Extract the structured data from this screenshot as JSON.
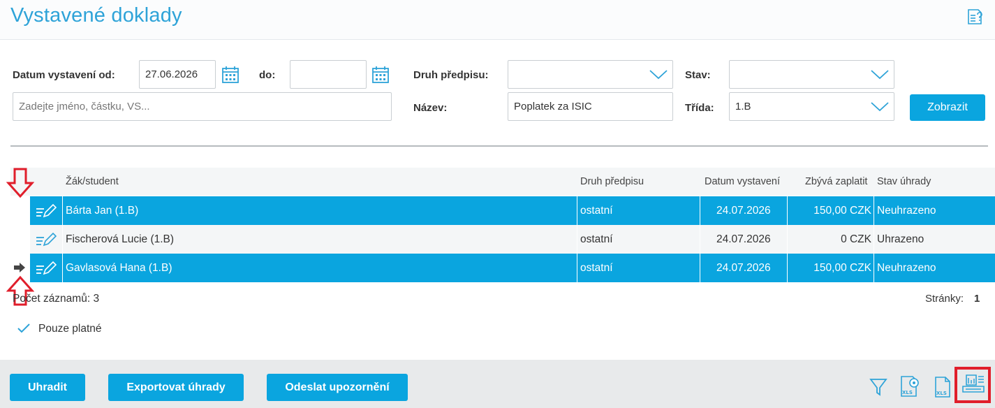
{
  "header": {
    "title": "Vystavené doklady",
    "help_icon": "help-document-icon"
  },
  "filters": {
    "date_from_label": "Datum vystavení od:",
    "date_from_value": "27.06.2026",
    "date_to_label": "do:",
    "date_to_value": "",
    "search_placeholder": "Zadejte jméno, částku, VS...",
    "prescription_type_label": "Druh předpisu:",
    "prescription_type_value": "",
    "name_label": "Název:",
    "name_value": "Poplatek za ISIC",
    "status_label": "Stav:",
    "status_value": "",
    "class_label": "Třída:",
    "class_value": "1.B",
    "show_button": "Zobrazit"
  },
  "grid": {
    "columns": [
      "Žák/student",
      "Druh předpisu",
      "Datum vystavení",
      "Zbývá zaplatit",
      "Stav úhrady"
    ],
    "rows": [
      {
        "student": "Bárta Jan (1.B)",
        "type": "ostatní",
        "date": "24.07.2026",
        "remaining": "150,00 CZK",
        "status": "Neuhrazeno",
        "selected": true
      },
      {
        "student": "Fischerová Lucie (1.B)",
        "type": "ostatní",
        "date": "24.07.2026",
        "remaining": "0 CZK",
        "status": "Uhrazeno",
        "selected": false
      },
      {
        "student": "Gavlasová Hana (1.B)",
        "type": "ostatní",
        "date": "24.07.2026",
        "remaining": "150,00 CZK",
        "status": "Neuhrazeno",
        "selected": true
      }
    ]
  },
  "footer": {
    "record_count": "Počet záznamů: 3",
    "pages_label": "Stránky:",
    "page_number": "1",
    "only_valid": "Pouze platné"
  },
  "actions": {
    "pay": "Uhradit",
    "export": "Exportovat úhrady",
    "send_reminder": "Odeslat upozornění"
  },
  "colors": {
    "accent": "#0aa5df",
    "title": "#2ea3d8",
    "annotation": "#e01e2b"
  }
}
